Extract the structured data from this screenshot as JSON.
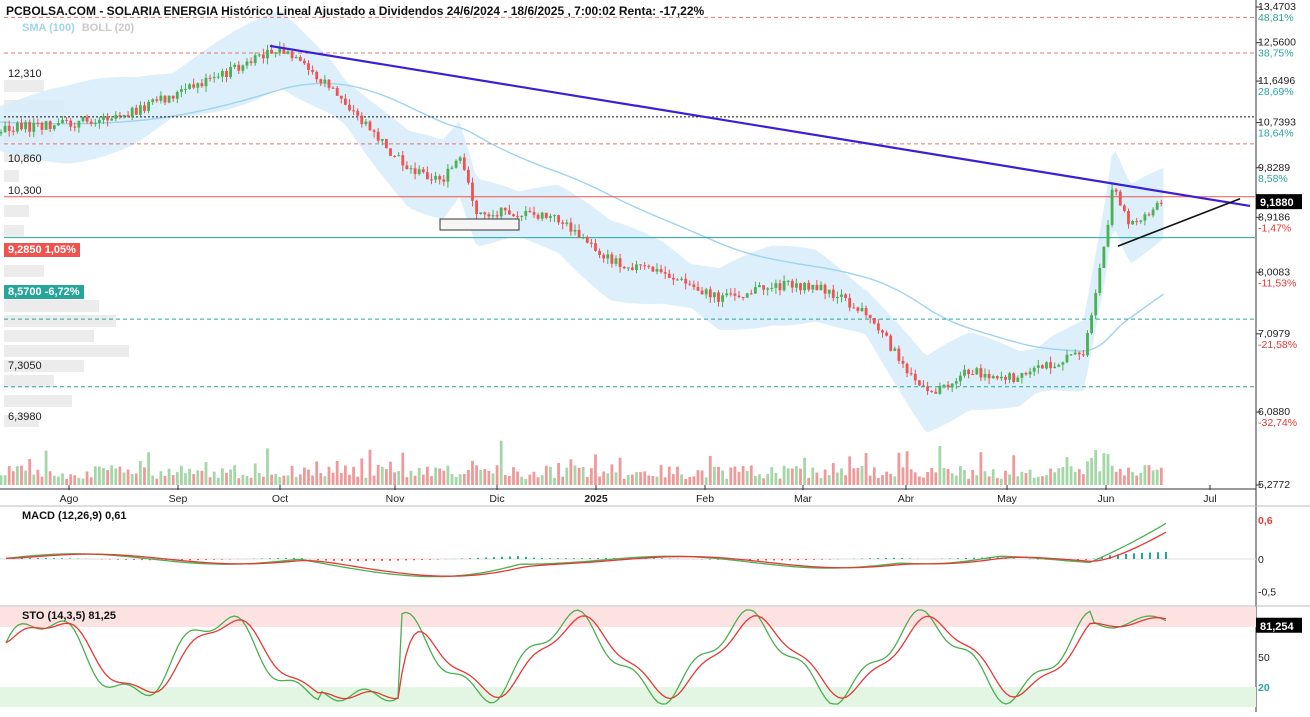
{
  "header": {
    "title": "PCBOLSA.COM - SOLARIA ENERGIA Histórico Lineal Ajustado a Dividendos 24/6/2024 - 18/6/2025 , 7:00:02 Renta: -17,22%",
    "legend_sma": "SMA (100)",
    "legend_boll": "BOLL (20)"
  },
  "colors": {
    "up": "#4caf50",
    "down": "#ef5350",
    "sma": "#9fd3f0",
    "boll_fill": "#d6ecfa",
    "trendline": "#3b1fd6",
    "red_tag": "#ef5350",
    "green_tag": "#26a69a"
  },
  "price_tags": {
    "red": "9,2850  1,05%",
    "green": "8,5700  -6,72%",
    "last": "9,1880"
  },
  "left_levels": [
    "12,310",
    "10,860",
    "10,300",
    "7,3050",
    "6,3980"
  ],
  "indicators": {
    "macd_title": "MACD (12,26,9)   0,61",
    "sto_title": "STO (14,3,5)   81,25",
    "sto_last": "81,254"
  },
  "chart_data": [
    {
      "type": "candlestick",
      "title": "PCBOLSA.COM - SOLARIA ENERGIA Histórico Lineal Ajustado a Dividendos 24/6/2024 - 18/6/2025 , 7:00:02 Renta: -17,22%",
      "x_tick_labels": [
        "Ago",
        "Sep",
        "Oct",
        "Nov",
        "Dic",
        "2025",
        "Feb",
        "Mar",
        "Abr",
        "May",
        "Jun",
        "Jul"
      ],
      "y_axis": {
        "scale": "log",
        "ylim": [
          5.2772,
          13.4703
        ],
        "ticks": [
          {
            "value": 13.4703,
            "label": "13,4703",
            "pct": "48,81%"
          },
          {
            "value": 12.56,
            "label": "12,5600",
            "pct": "38,75%"
          },
          {
            "value": 11.6496,
            "label": "11,6496",
            "pct": "28,69%"
          },
          {
            "value": 10.7393,
            "label": "10,7393",
            "pct": "18,64%"
          },
          {
            "value": 9.8289,
            "label": "9,8289",
            "pct": "8,58%"
          },
          {
            "value": 8.9186,
            "label": "8,9186",
            "pct": "-1,47%"
          },
          {
            "value": 8.0083,
            "label": "8,0083",
            "pct": "-11,53%"
          },
          {
            "value": 7.0979,
            "label": "7,0979",
            "pct": "-21,58%"
          },
          {
            "value": 6.088,
            "label": "6,0880",
            "pct": "-32,74%"
          },
          {
            "value": 5.2772,
            "label": "5,2772",
            "pct": ""
          }
        ]
      },
      "horizontal_levels": [
        12.31,
        10.86,
        10.3,
        9.285,
        8.57,
        7.305,
        6.398
      ],
      "key_prices": [
        {
          "x": "2024-06-24",
          "price": 10.8
        },
        {
          "x": "2024-07-10",
          "price": 10.6
        },
        {
          "x": "2024-08-01",
          "price": 10.7
        },
        {
          "x": "2024-08-20",
          "price": 11.0
        },
        {
          "x": "2024-09-05",
          "price": 11.5
        },
        {
          "x": "2024-09-20",
          "price": 12.0
        },
        {
          "x": "2024-10-01",
          "price": 12.4
        },
        {
          "x": "2024-10-15",
          "price": 11.5
        },
        {
          "x": "2024-10-25",
          "price": 10.6
        },
        {
          "x": "2024-11-05",
          "price": 9.8
        },
        {
          "x": "2024-11-15",
          "price": 9.6
        },
        {
          "x": "2024-11-20",
          "price": 10.0
        },
        {
          "x": "2024-11-25",
          "price": 9.0
        },
        {
          "x": "2024-12-05",
          "price": 9.0
        },
        {
          "x": "2024-12-20",
          "price": 8.9
        },
        {
          "x": "2025-01-05",
          "price": 8.2
        },
        {
          "x": "2025-01-20",
          "price": 8.0
        },
        {
          "x": "2025-02-05",
          "price": 7.6
        },
        {
          "x": "2025-02-20",
          "price": 7.8
        },
        {
          "x": "2025-03-05",
          "price": 7.8
        },
        {
          "x": "2025-03-20",
          "price": 7.4
        },
        {
          "x": "2025-04-07",
          "price": 6.3
        },
        {
          "x": "2025-04-20",
          "price": 6.6
        },
        {
          "x": "2025-05-05",
          "price": 6.5
        },
        {
          "x": "2025-05-15",
          "price": 6.7
        },
        {
          "x": "2025-05-25",
          "price": 6.8
        },
        {
          "x": "2025-06-01",
          "price": 8.6
        },
        {
          "x": "2025-06-03",
          "price": 9.5
        },
        {
          "x": "2025-06-08",
          "price": 8.8
        },
        {
          "x": "2025-06-18",
          "price": 9.188
        }
      ]
    },
    {
      "type": "line",
      "title": "MACD (12,26,9)",
      "last": 0.61,
      "ylim": [
        -0.5,
        0.6
      ],
      "ticks": [
        "0,6",
        "0",
        "-0,5"
      ]
    },
    {
      "type": "line",
      "title": "STO (14,3,5)",
      "last": 81.25,
      "ticks": [
        "50",
        "20"
      ],
      "zones": {
        "overbought": 80,
        "oversold": 20
      }
    }
  ]
}
